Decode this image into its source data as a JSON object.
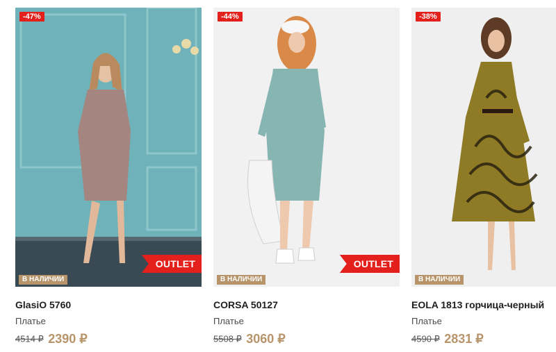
{
  "products": [
    {
      "discount": "-47%",
      "badge_outlet": "OUTLET",
      "stock": "В НАЛИЧИИ",
      "name": "GlasiO 5760",
      "category": "Платье",
      "old_price": "4514 ₽",
      "price": "2390 ₽"
    },
    {
      "discount": "-44%",
      "badge_outlet": "OUTLET",
      "stock": "В НАЛИЧИИ",
      "name": "CORSA 50127",
      "category": "Платье",
      "old_price": "5508 ₽",
      "price": "3060 ₽"
    },
    {
      "discount": "-38%",
      "stock": "В НАЛИЧИИ",
      "name": "EOLA 1813 горчица-черный",
      "category": "Платье",
      "old_price": "4590 ₽",
      "price": "2831 ₽"
    }
  ],
  "colors": {
    "sale_red": "#e3201b",
    "accent_gold": "#b8946a"
  }
}
